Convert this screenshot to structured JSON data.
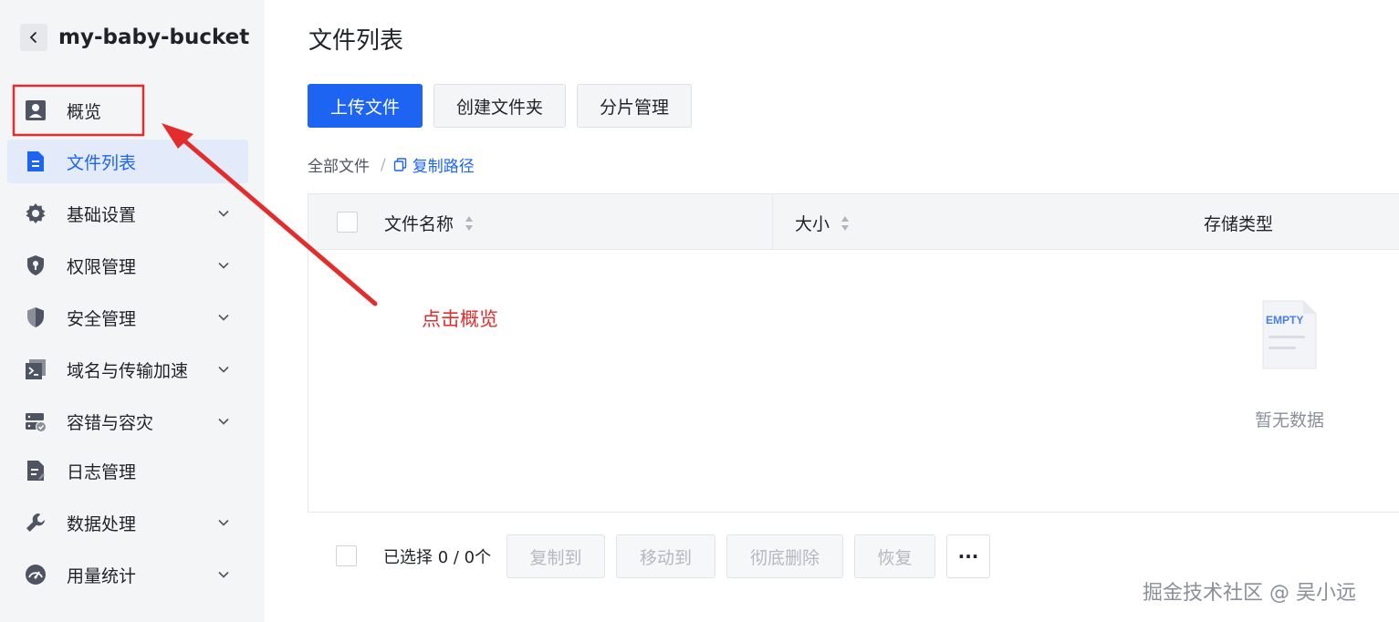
{
  "sidebar": {
    "bucket_name": "my-baby-bucket",
    "items": [
      {
        "label": "概览",
        "icon": "user-card-icon"
      },
      {
        "label": "文件列表",
        "icon": "file-icon",
        "active": true
      },
      {
        "label": "基础设置",
        "icon": "gear-icon"
      },
      {
        "label": "权限管理",
        "icon": "shield-keyhole-icon"
      },
      {
        "label": "安全管理",
        "icon": "shield-icon"
      },
      {
        "label": "域名与传输加速",
        "icon": "terminal-icon"
      },
      {
        "label": "容错与容灾",
        "icon": "server-check-icon"
      },
      {
        "label": "日志管理",
        "icon": "log-file-icon"
      },
      {
        "label": "数据处理",
        "icon": "wrench-icon"
      },
      {
        "label": "用量统计",
        "icon": "gauge-icon"
      }
    ]
  },
  "main": {
    "title": "文件列表",
    "toolbar": {
      "upload": "上传文件",
      "create_folder": "创建文件夹",
      "multipart": "分片管理"
    },
    "breadcrumb": {
      "all_files": "全部文件",
      "separator": "/",
      "copy_path": "复制路径"
    },
    "table": {
      "columns": [
        "文件名称",
        "大小",
        "存储类型"
      ],
      "empty_image_text": "EMPTY",
      "empty_text": "暂无数据"
    },
    "footer": {
      "selected": "已选择 0 / 0个",
      "copy_to": "复制到",
      "move_to": "移动到",
      "delete_forever": "彻底删除",
      "restore": "恢复",
      "more": "···"
    }
  },
  "annotation": {
    "text": "点击概览",
    "color": "#e32d2d"
  },
  "watermark": "掘金技术社区 @ 吴小远",
  "colors": {
    "primary": "#1d64f2",
    "active_bg": "#e3ebfb",
    "sidebar_bg": "#f4f5f7"
  }
}
